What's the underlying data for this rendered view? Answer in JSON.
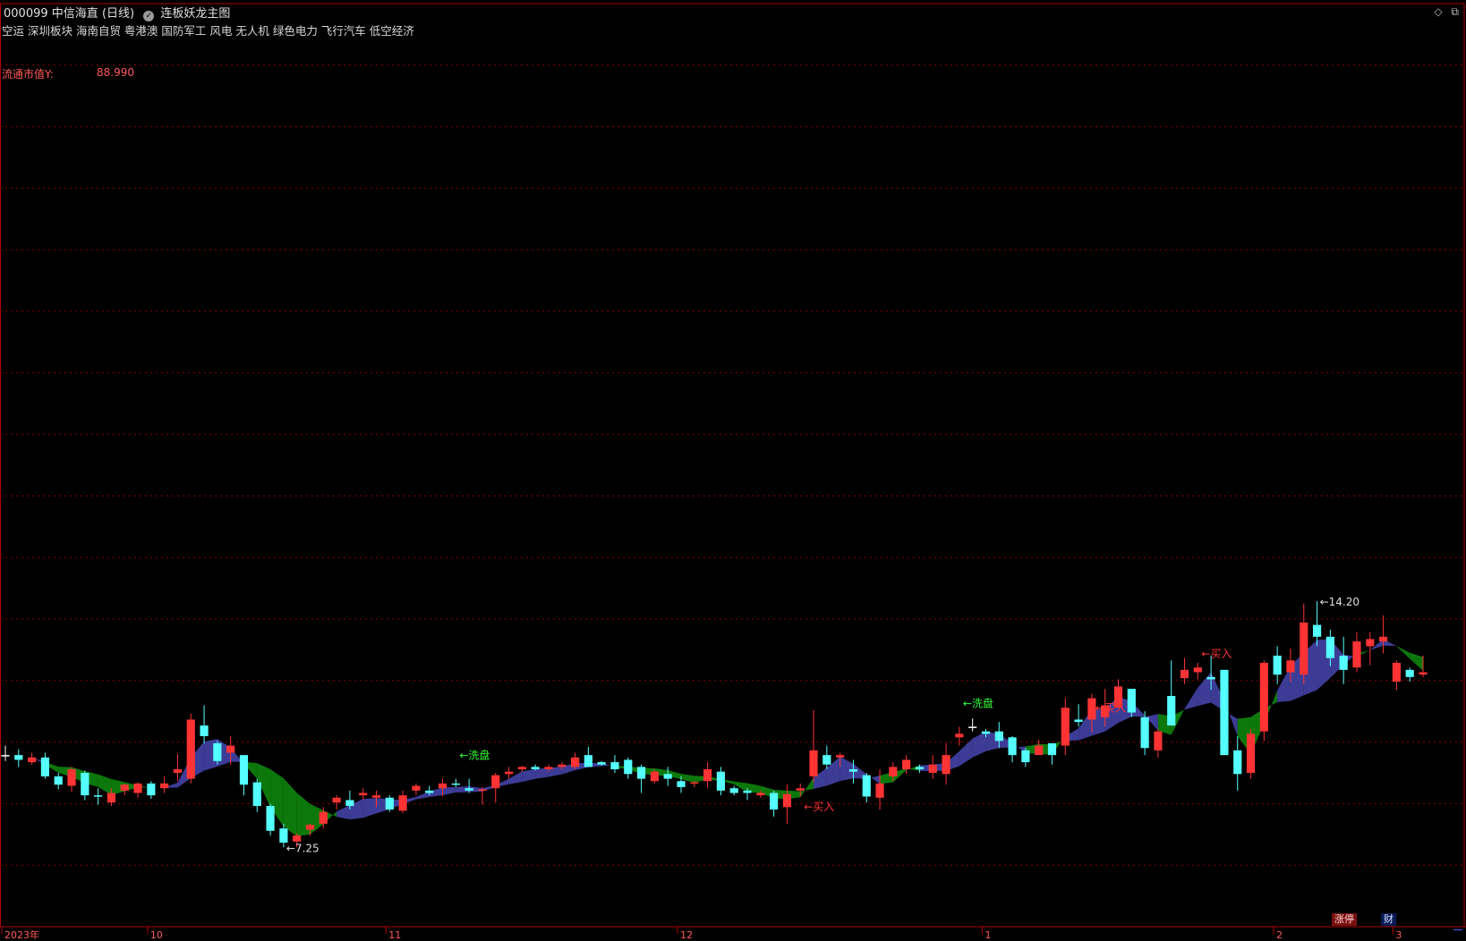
{
  "header": {
    "stock_code": "000099",
    "stock_name": "中信海直",
    "period": "(日线)",
    "indicator": "连板妖龙主图",
    "sectors": "空运 深圳板块 海南自贸 粤港澳 国防军工 风电 无人机 绿色电力 飞行汽车 低空经济",
    "mcap_label": "流通市值Y:",
    "mcap_value": "88.990"
  },
  "buttons": {
    "zhangting": "涨停",
    "cai": "财"
  },
  "icons": [
    "diamond-icon",
    "restore-icon"
  ],
  "colors": {
    "up": "#ff3333",
    "down": "#55ffff",
    "doji": "#ffffff",
    "band_up": "#3c3c96",
    "band_down": "#0c780c",
    "grid": "#8b0000",
    "axis": "#b00000",
    "sell": "#ffff33"
  },
  "chart_data": {
    "type": "candlestick",
    "x_axis_labels": [
      "2023年",
      "10",
      "11",
      "12",
      "1",
      "2",
      "3"
    ],
    "ylim": [
      6.75,
      14.55
    ],
    "price_high_label": "14.20",
    "price_low_label": "7.25",
    "annotations": [
      "洗盘",
      "买入",
      "洗盘",
      "买入",
      "买入",
      "买入"
    ],
    "series_ohlc": [
      [
        8.2,
        8.28,
        8.15,
        8.2
      ],
      [
        8.2,
        8.25,
        8.1,
        8.16
      ],
      [
        8.14,
        8.22,
        8.12,
        8.18
      ],
      [
        8.18,
        8.22,
        8.0,
        8.02
      ],
      [
        8.02,
        8.05,
        7.91,
        7.95
      ],
      [
        7.94,
        8.1,
        7.89,
        8.08
      ],
      [
        8.05,
        8.07,
        7.82,
        7.86
      ],
      [
        7.86,
        7.92,
        7.78,
        7.85
      ],
      [
        7.8,
        7.92,
        7.77,
        7.88
      ],
      [
        7.9,
        7.96,
        7.86,
        7.95
      ],
      [
        7.88,
        7.97,
        7.84,
        7.96
      ],
      [
        7.96,
        7.98,
        7.83,
        7.86
      ],
      [
        7.92,
        8.02,
        7.88,
        7.96
      ],
      [
        8.05,
        8.21,
        7.98,
        8.08
      ],
      [
        8.0,
        8.55,
        7.96,
        8.5
      ],
      [
        8.45,
        8.62,
        8.3,
        8.36
      ],
      [
        8.3,
        8.32,
        8.12,
        8.15
      ],
      [
        8.22,
        8.36,
        8.12,
        8.28
      ],
      [
        8.2,
        8.2,
        7.86,
        7.95
      ],
      [
        7.97,
        8.0,
        7.72,
        7.77
      ],
      [
        7.77,
        7.79,
        7.52,
        7.56
      ],
      [
        7.58,
        7.62,
        7.42,
        7.46
      ],
      [
        7.47,
        7.54,
        7.42,
        7.52
      ],
      [
        7.57,
        7.62,
        7.52,
        7.61
      ],
      [
        7.62,
        7.76,
        7.58,
        7.72
      ],
      [
        7.8,
        7.86,
        7.74,
        7.84
      ],
      [
        7.82,
        7.9,
        7.74,
        7.77
      ],
      [
        7.86,
        7.92,
        7.82,
        7.88
      ],
      [
        7.84,
        7.9,
        7.76,
        7.86
      ],
      [
        7.84,
        7.86,
        7.72,
        7.74
      ],
      [
        7.73,
        7.9,
        7.71,
        7.86
      ],
      [
        7.9,
        7.96,
        7.86,
        7.94
      ],
      [
        7.9,
        7.94,
        7.86,
        7.88
      ],
      [
        7.92,
        8.0,
        7.85,
        7.96
      ],
      [
        7.96,
        8.0,
        7.93,
        7.95
      ],
      [
        7.92,
        8.0,
        7.88,
        7.9
      ],
      [
        7.9,
        7.93,
        7.78,
        7.91
      ],
      [
        7.92,
        8.05,
        7.8,
        8.03
      ],
      [
        8.04,
        8.1,
        8.0,
        8.06
      ],
      [
        8.08,
        8.11,
        8.06,
        8.1
      ],
      [
        8.1,
        8.12,
        8.07,
        8.08
      ],
      [
        8.08,
        8.12,
        8.06,
        8.1
      ],
      [
        8.1,
        8.14,
        8.08,
        8.12
      ],
      [
        8.1,
        8.22,
        8.08,
        8.18
      ],
      [
        8.2,
        8.27,
        8.17,
        8.1
      ],
      [
        8.14,
        8.15,
        8.11,
        8.12
      ],
      [
        8.14,
        8.2,
        8.05,
        8.08
      ],
      [
        8.16,
        8.18,
        8.0,
        8.04
      ],
      [
        8.1,
        8.12,
        7.88,
        8.0
      ],
      [
        7.98,
        8.08,
        7.96,
        8.06
      ],
      [
        8.04,
        8.1,
        7.94,
        8.0
      ],
      [
        7.98,
        8.02,
        7.88,
        7.93
      ],
      [
        7.96,
        7.98,
        7.93,
        7.97
      ],
      [
        7.98,
        8.14,
        7.92,
        8.08
      ],
      [
        8.06,
        8.1,
        7.86,
        7.9
      ],
      [
        7.92,
        7.94,
        7.86,
        7.88
      ],
      [
        7.9,
        7.92,
        7.82,
        7.88
      ],
      [
        7.86,
        7.9,
        7.84,
        7.88
      ],
      [
        7.88,
        7.9,
        7.68,
        7.74
      ],
      [
        7.76,
        7.95,
        7.62,
        7.87
      ],
      [
        7.9,
        7.96,
        7.85,
        7.92
      ],
      [
        8.02,
        8.58,
        7.97,
        8.24
      ],
      [
        8.2,
        8.28,
        8.08,
        8.12
      ],
      [
        8.18,
        8.22,
        8.1,
        8.2
      ],
      [
        8.08,
        8.16,
        7.96,
        8.06
      ],
      [
        8.03,
        8.05,
        7.8,
        7.85
      ],
      [
        7.84,
        8.08,
        7.74,
        7.96
      ],
      [
        8.02,
        8.14,
        7.98,
        8.1
      ],
      [
        8.08,
        8.2,
        8.04,
        8.16
      ],
      [
        8.1,
        8.12,
        8.05,
        8.08
      ],
      [
        8.05,
        8.2,
        8.0,
        8.12
      ],
      [
        8.04,
        8.3,
        7.95,
        8.2
      ],
      [
        8.35,
        8.44,
        8.28,
        8.38
      ],
      [
        8.44,
        8.51,
        8.4,
        8.44
      ],
      [
        8.4,
        8.42,
        8.35,
        8.38
      ],
      [
        8.4,
        8.48,
        8.26,
        8.32
      ],
      [
        8.35,
        8.36,
        8.14,
        8.2
      ],
      [
        8.24,
        8.26,
        8.1,
        8.14
      ],
      [
        8.2,
        8.33,
        8.22,
        8.28
      ],
      [
        8.3,
        8.3,
        8.12,
        8.2
      ],
      [
        8.28,
        8.68,
        8.2,
        8.6
      ],
      [
        8.5,
        8.63,
        8.44,
        8.48
      ],
      [
        8.5,
        8.72,
        8.39,
        8.68
      ],
      [
        8.52,
        8.76,
        8.44,
        8.62
      ],
      [
        8.6,
        8.84,
        8.6,
        8.78
      ],
      [
        8.76,
        8.76,
        8.52,
        8.56
      ],
      [
        8.52,
        8.57,
        8.2,
        8.26
      ],
      [
        8.24,
        8.42,
        8.18,
        8.4
      ],
      [
        8.7,
        9.0,
        8.45,
        8.45
      ],
      [
        8.85,
        9.02,
        8.8,
        8.92
      ],
      [
        8.9,
        8.98,
        8.84,
        8.94
      ],
      [
        8.86,
        9.04,
        8.75,
        8.84
      ],
      [
        8.92,
        8.92,
        8.3,
        8.2
      ],
      [
        8.24,
        8.36,
        7.9,
        8.04
      ],
      [
        8.05,
        8.42,
        8.0,
        8.38
      ],
      [
        8.4,
        9.0,
        8.32,
        8.98
      ],
      [
        9.04,
        9.12,
        8.8,
        8.88
      ],
      [
        8.9,
        9.1,
        8.82,
        9.0
      ],
      [
        8.88,
        9.48,
        8.8,
        9.32
      ],
      [
        9.3,
        9.5,
        9.12,
        9.2
      ],
      [
        9.2,
        9.26,
        8.95,
        9.02
      ],
      [
        9.04,
        9.2,
        8.8,
        8.92
      ],
      [
        8.94,
        9.24,
        8.9,
        9.16
      ],
      [
        9.12,
        9.24,
        8.96,
        9.18
      ],
      [
        9.16,
        9.38,
        9.06,
        9.2
      ],
      [
        8.82,
        9.0,
        8.75,
        8.98
      ],
      [
        8.92,
        8.94,
        8.82,
        8.86
      ],
      [
        8.88,
        9.04,
        8.86,
        8.9
      ]
    ]
  }
}
